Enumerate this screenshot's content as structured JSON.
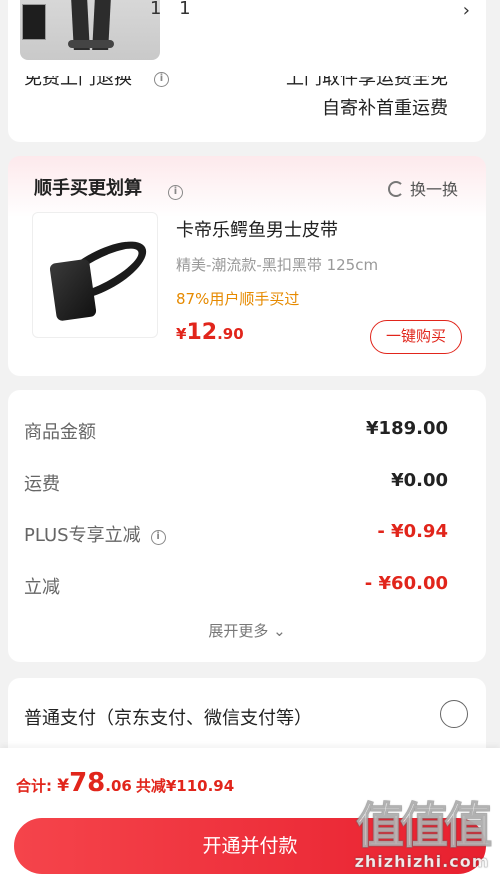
{
  "product": {
    "quantity_text": "1 1",
    "chevron": "›"
  },
  "returns": {
    "left_label": "免费上门退换",
    "right_line1": "上门取件享运费全免",
    "right_line2": "自寄补首重运费"
  },
  "upsell": {
    "title": "顺手买更划算",
    "swap_label": "换一换",
    "item": {
      "name": "卡帝乐鳄鱼男士皮带",
      "spec": "精美-潮流款-黑扣黑带   125cm",
      "buy_rate": "87%用户顺手买过",
      "price_symbol": "¥",
      "price_int": "12",
      "price_dec": ".90",
      "buy_button": "一键购买"
    }
  },
  "summary": {
    "rows": [
      {
        "label": "商品金额",
        "value": "¥189.00"
      },
      {
        "label": "运费",
        "value": "¥0.00"
      },
      {
        "label": "PLUS专享立减",
        "value": "- ¥0.94"
      },
      {
        "label": "立减",
        "value": "- ¥60.00"
      }
    ],
    "expand_label": "展开更多 ⌄"
  },
  "payment": {
    "method_label": "普通支付（京东支付、微信支付等）"
  },
  "bottom": {
    "total_label": "合计: ",
    "total_symbol": "¥",
    "total_int": "78",
    "total_dec": ".06",
    "saved": "共减¥110.94",
    "pay_button": "开通并付款"
  },
  "watermark": {
    "logo": "值值值",
    "url": "zhizhizhi.com"
  },
  "colors": {
    "accent_red": "#e1251b",
    "orange": "#e68a00"
  }
}
